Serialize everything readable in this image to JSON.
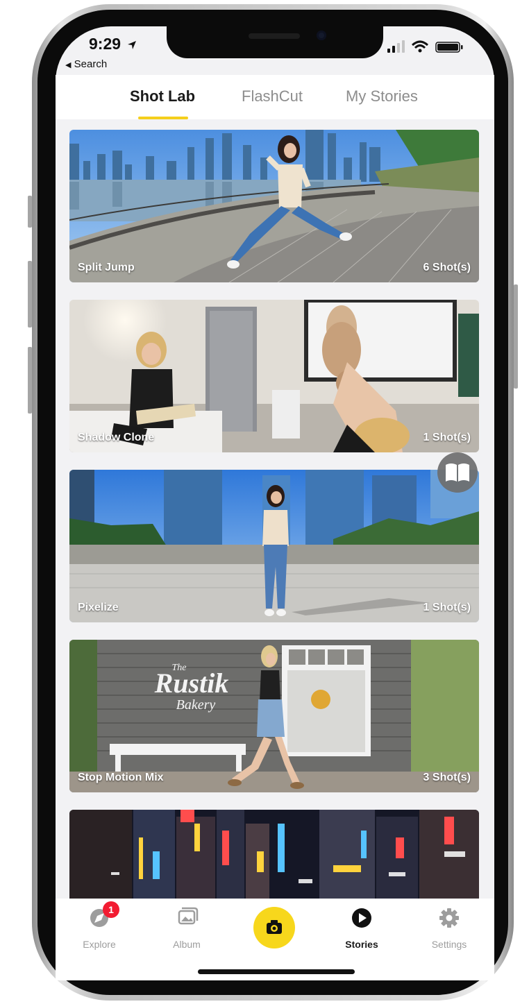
{
  "status": {
    "time": "9:29",
    "back_label": "Search"
  },
  "tabs": [
    {
      "label": "Shot Lab",
      "active": true
    },
    {
      "label": "FlashCut",
      "active": false
    },
    {
      "label": "My Stories",
      "active": false
    }
  ],
  "cards": [
    {
      "title": "Split Jump",
      "count": "6 Shot(s)"
    },
    {
      "title": "Shadow Clone",
      "count": "1 Shot(s)"
    },
    {
      "title": "Pixelize",
      "count": "1 Shot(s)"
    },
    {
      "title": "Stop Motion Mix",
      "count": "3 Shot(s)"
    }
  ],
  "bakery_sign": {
    "line1": "The",
    "line2": "Rustik",
    "line3": "Bakery"
  },
  "nav": [
    {
      "label": "Explore",
      "icon": "explore-icon",
      "badge": "1"
    },
    {
      "label": "Album",
      "icon": "album-icon"
    },
    {
      "label": "",
      "icon": "camera-icon"
    },
    {
      "label": "Stories",
      "icon": "stories-play-icon",
      "active": true
    },
    {
      "label": "Settings",
      "icon": "settings-gear-icon"
    }
  ],
  "colors": {
    "accent": "#f5cf1b",
    "badge": "#f21c32"
  }
}
